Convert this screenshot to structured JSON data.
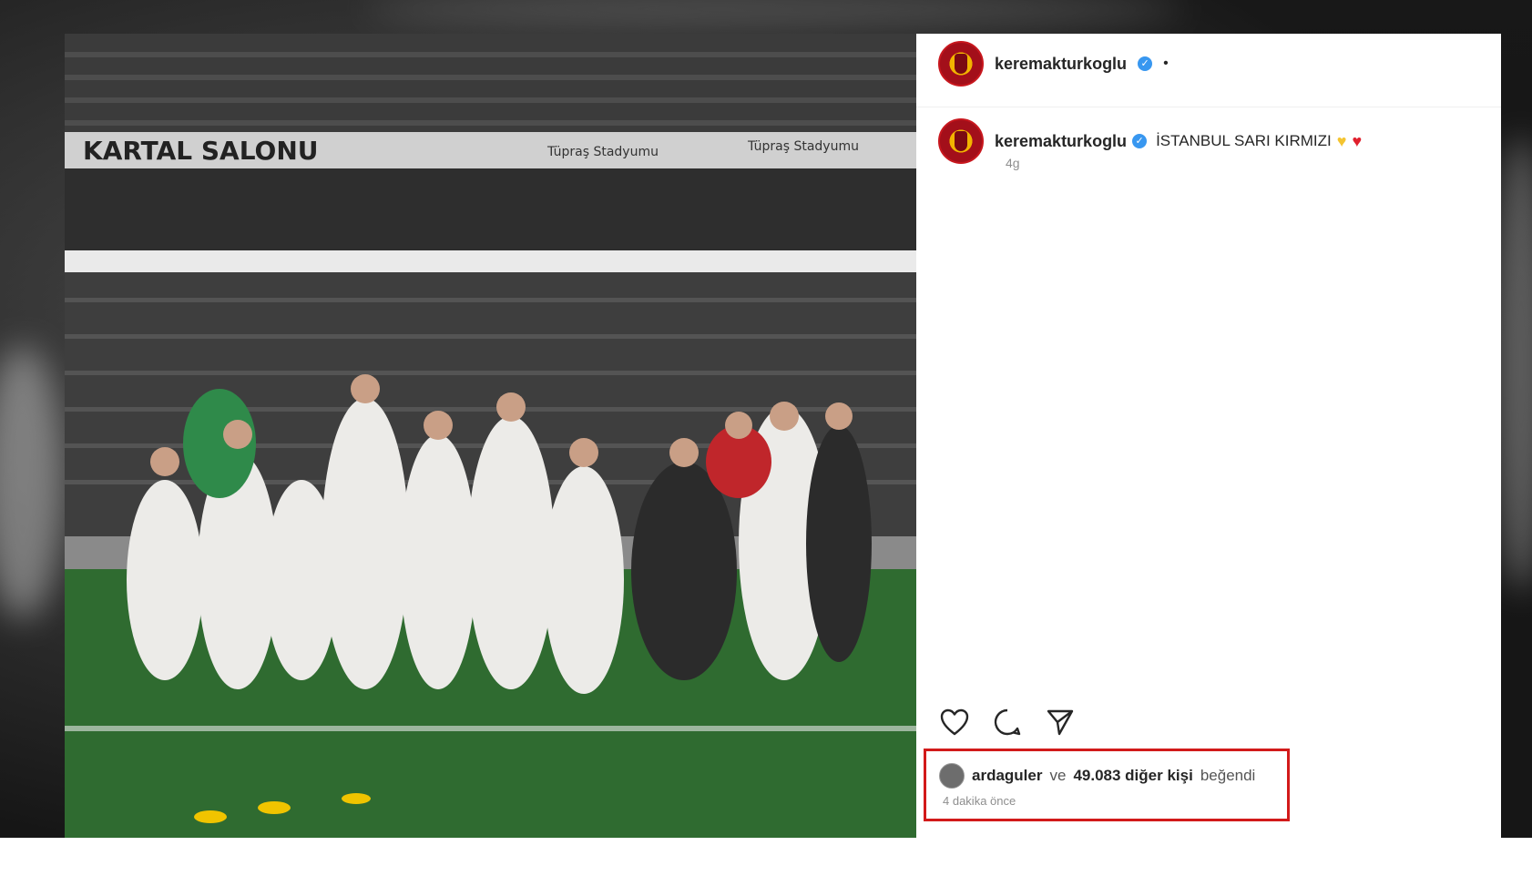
{
  "colors": {
    "verified": "#3897f0",
    "highlight": "#d21a1a",
    "heart_yellow": "#f4c430",
    "heart_red": "#e0202d"
  },
  "post": {
    "header": {
      "username": "keremakturkoglu",
      "verified_icon": "verified-badge-icon",
      "dot": "•"
    },
    "caption": {
      "username": "keremakturkoglu",
      "text": "İSTANBUL SARI KIRMIZI",
      "time": "4g"
    },
    "actions": {
      "like_icon": "heart-icon",
      "comment_icon": "comment-icon",
      "share_icon": "send-icon"
    },
    "likes": {
      "liker": "ardaguler",
      "connector": "ve",
      "count_text": "49.083 diğer kişi",
      "suffix": "beğendi",
      "time": "4 dakika önce"
    }
  },
  "photo": {
    "banner_left": "KARTAL SALONU",
    "banner_right_1": "Tüpraş Stadyumu",
    "banner_right_2": "Tüpraş Stadyumu"
  }
}
